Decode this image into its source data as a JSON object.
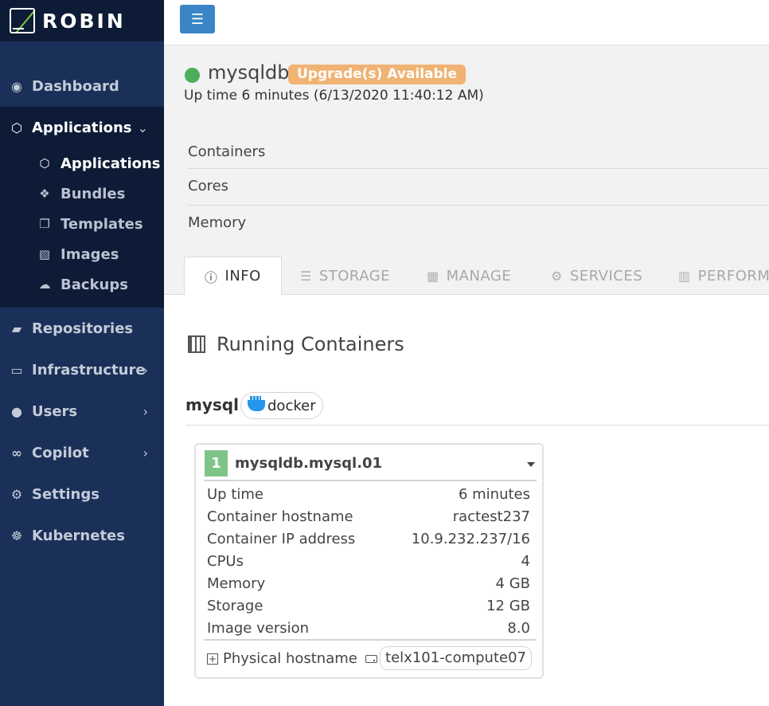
{
  "brand": {
    "name": "ROBIN"
  },
  "sidebar": {
    "items": [
      {
        "label": "Dashboard",
        "icon": "dashboard-icon"
      },
      {
        "label": "Applications",
        "icon": "cube-icon"
      },
      {
        "label": "Repositories",
        "icon": "folder-icon"
      },
      {
        "label": "Infrastructure",
        "icon": "hdd-icon"
      },
      {
        "label": "Users",
        "icon": "user-icon"
      },
      {
        "label": "Copilot",
        "icon": "binoculars-icon"
      },
      {
        "label": "Settings",
        "icon": "gears-icon"
      },
      {
        "label": "Kubernetes",
        "icon": "helm-icon"
      }
    ],
    "sub_items": [
      {
        "label": "Applications",
        "icon": "cube-icon"
      },
      {
        "label": "Bundles",
        "icon": "cubes-icon"
      },
      {
        "label": "Templates",
        "icon": "copy-icon"
      },
      {
        "label": "Images",
        "icon": "image-file-icon"
      },
      {
        "label": "Backups",
        "icon": "cloud-upload-icon"
      }
    ]
  },
  "app": {
    "name": "mysqldb",
    "badge": "Upgrade(s) Available",
    "uptime_line": "Up time 6 minutes  (6/13/2020 11:40:12 AM)",
    "status_color": "#4cae5a",
    "summary": [
      "Containers",
      "Cores",
      "Memory"
    ]
  },
  "tabs": [
    {
      "label": "INFO",
      "icon": "info-circle-icon"
    },
    {
      "label": "STORAGE",
      "icon": "database-icon"
    },
    {
      "label": "MANAGE",
      "icon": "calendar-icon"
    },
    {
      "label": "SERVICES",
      "icon": "gears-icon"
    },
    {
      "label": "PERFORM",
      "icon": "bar-chart-icon"
    }
  ],
  "section": {
    "title": "Running Containers"
  },
  "service": {
    "name": "mysql",
    "engine": "docker"
  },
  "container": {
    "index": "1",
    "title": "mysqldb.mysql.01",
    "rows": [
      {
        "key": "Up time",
        "value": "6 minutes"
      },
      {
        "key": "Container hostname",
        "value": "ractest237"
      },
      {
        "key": "Container IP address",
        "value": "10.9.232.237/16"
      },
      {
        "key": "CPUs",
        "value": "4"
      },
      {
        "key": "Memory",
        "value": "4 GB"
      },
      {
        "key": "Storage",
        "value": "12 GB"
      },
      {
        "key": "Image version",
        "value": "8.0"
      }
    ],
    "physical_label": "Physical hostname",
    "physical_host": "telx101-compute07"
  }
}
